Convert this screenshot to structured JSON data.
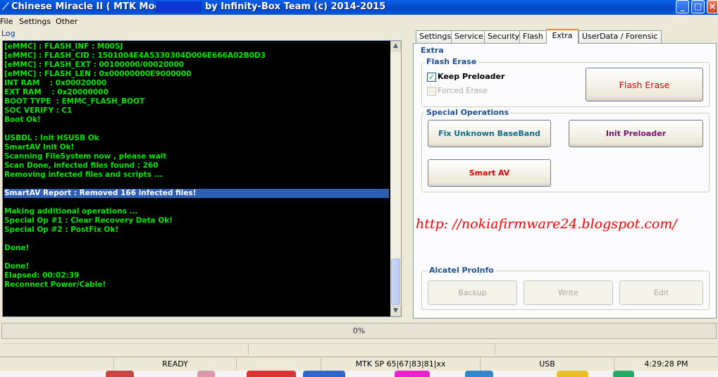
{
  "window": {
    "title": "Chinese Miracle II ( MTK Module ,",
    "title_owner": "by Infinity-Box Team (c) 2014-2015",
    "controls": {
      "minimize": "_",
      "maximize": "□",
      "close": "×"
    }
  },
  "menu": [
    "File",
    "Settings",
    "Other"
  ],
  "log": {
    "label": "Log",
    "lines": [
      "[eMMC] : FLASH_INF : M00SJ",
      "[eMMC] : FLASH_CID : 1501004E4A5330304D006E666A02B0D3",
      "[eMMC] : FLASH_EXT : 00100000/00020000",
      "[eMMC] : FLASH_LEN : 0x00000000E9000000",
      "INT RAM    : 0x00020000",
      "EXT RAM    : 0x20000000",
      "BOOT TYPE  : EMMC_FLASH_BOOT",
      "SOC VERIFY : C1",
      "Boot Ok!",
      "",
      "USBDL : Init HSUSB Ok",
      "SmartAV Init Ok!",
      "Scanning FileSystem now , please wait",
      "Scan Done, infected files found : 260",
      "Removing infected files and scripts ...",
      "",
      "SmartAV Report : Removed 166 infected files!",
      "",
      "Making additional operations ...",
      "Special Op #1 : Clear Recovery Data Ok!",
      "Special Op #2 : PostFix Ok!",
      "",
      "Done!",
      "",
      "Done!",
      "Elapsed: 00:02:39",
      "Reconnect Power/Cable!"
    ],
    "highlighted_line_index": 16,
    "scroll": {
      "up": "▲",
      "down": "▼"
    }
  },
  "tabs": [
    {
      "label": "Settings"
    },
    {
      "label": "Service"
    },
    {
      "label": "Security"
    },
    {
      "label": "Flash"
    },
    {
      "label": "Extra"
    },
    {
      "label": "UserData / Forensic"
    }
  ],
  "active_tab": "Extra",
  "extra": {
    "group_title": "Extra",
    "flash_erase": {
      "title": "Flash Erase",
      "keep_preloader_label": "Keep Preloader",
      "keep_preloader_checked": true,
      "forced_erase_label": "Forced Erase",
      "forced_erase_checked": false,
      "check_mark": "✓",
      "button": "Flash Erase"
    },
    "special_operations": {
      "title": "Special Operations",
      "fix_unknown_baseband": "Fix Unknown BaseBand",
      "init_preloader": "Init Preloader",
      "smart_av": "Smart AV"
    },
    "watermark": "http: //nokiafirmware24.blogspot.com/",
    "alcatel_proinfo": {
      "title": "Alcatel ProInfo",
      "backup": "Backup",
      "write": "Write",
      "edit": "Edit"
    }
  },
  "progress": {
    "text": "0%",
    "value": 0
  },
  "statusbar": {
    "state": "READY",
    "platform": "MTK SP 65|67|83|81|xx",
    "connection": "USB",
    "time": "4:29:28 PM"
  },
  "colors": {
    "log_text": "#00e600",
    "log_highlight": "#2f5fb4",
    "flash_erase_text": "#e00000",
    "fix_baseband_text": "#0f6b8a",
    "init_preloader_text": "#7a0f6e",
    "smart_av_text": "#e00000",
    "watermark": "#ff0000"
  }
}
